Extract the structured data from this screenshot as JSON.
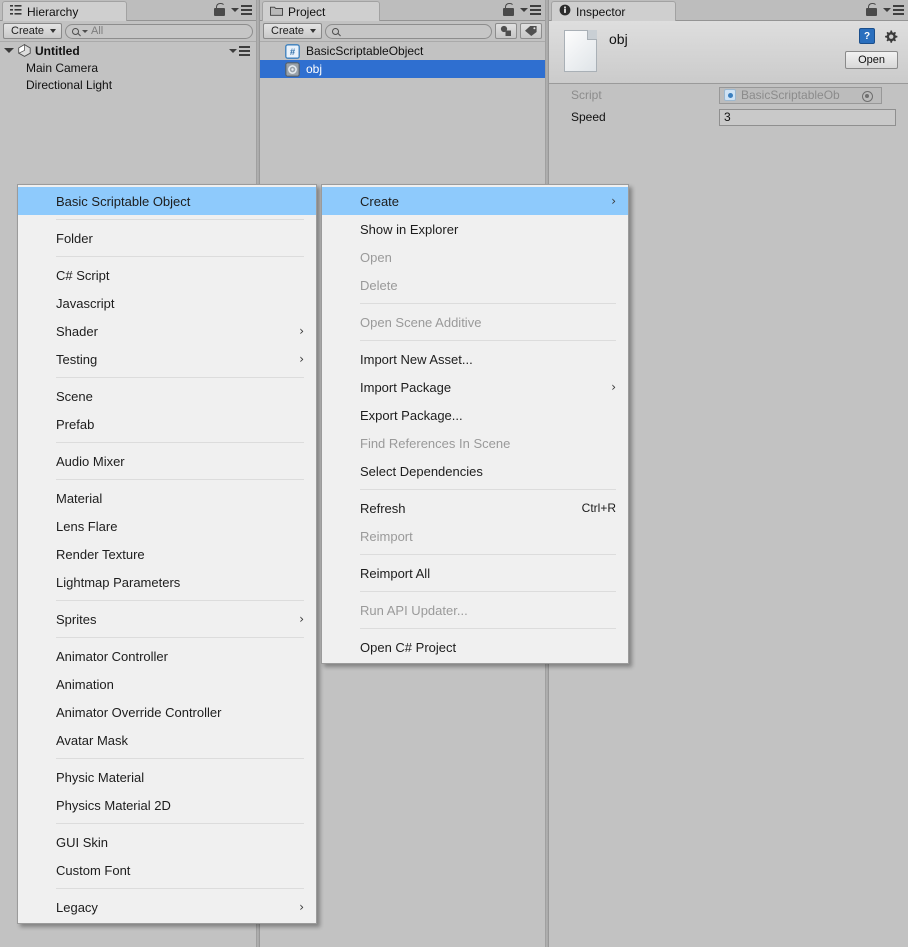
{
  "app": "Unity Editor",
  "panels": {
    "hierarchy": {
      "tab_label": "Hierarchy",
      "tab_icon": "hierarchy-icon",
      "create_label": "Create",
      "search_placeholder": "All",
      "root": {
        "label": "Untitled",
        "icon": "unity-scene-icon"
      },
      "items": [
        {
          "label": "Main Camera"
        },
        {
          "label": "Directional Light"
        }
      ]
    },
    "project": {
      "tab_label": "Project",
      "tab_icon": "folder-icon",
      "create_label": "Create",
      "search_placeholder": "",
      "filter_buttons": [
        "type-filter-icon",
        "label-filter-icon"
      ],
      "assets": [
        {
          "label": "BasicScriptableObject",
          "icon": "csharp-script-icon",
          "selected": false
        },
        {
          "label": "obj",
          "icon": "scriptable-object-asset-icon",
          "selected": true
        }
      ]
    },
    "inspector": {
      "tab_label": "Inspector",
      "tab_icon": "info-icon",
      "object_name": "obj",
      "help_icon": "?",
      "open_label": "Open",
      "properties": [
        {
          "label": "Script",
          "value": "BasicScriptableOb",
          "type": "object",
          "disabled": true
        },
        {
          "label": "Speed",
          "value": "3",
          "type": "number",
          "disabled": false
        }
      ]
    }
  },
  "context_menus": {
    "create_submenu": {
      "name": "Create",
      "items": [
        {
          "label": "Basic Scriptable Object",
          "highlighted": true
        },
        {
          "separator": true
        },
        {
          "label": "Folder"
        },
        {
          "separator": true
        },
        {
          "label": "C# Script"
        },
        {
          "label": "Javascript"
        },
        {
          "label": "Shader",
          "submenu": true
        },
        {
          "label": "Testing",
          "submenu": true
        },
        {
          "separator": true
        },
        {
          "label": "Scene"
        },
        {
          "label": "Prefab"
        },
        {
          "separator": true
        },
        {
          "label": "Audio Mixer"
        },
        {
          "separator": true
        },
        {
          "label": "Material"
        },
        {
          "label": "Lens Flare"
        },
        {
          "label": "Render Texture"
        },
        {
          "label": "Lightmap Parameters"
        },
        {
          "separator": true
        },
        {
          "label": "Sprites",
          "submenu": true
        },
        {
          "separator": true
        },
        {
          "label": "Animator Controller"
        },
        {
          "label": "Animation"
        },
        {
          "label": "Animator Override Controller"
        },
        {
          "label": "Avatar Mask"
        },
        {
          "separator": true
        },
        {
          "label": "Physic Material"
        },
        {
          "label": "Physics Material 2D"
        },
        {
          "separator": true
        },
        {
          "label": "GUI Skin"
        },
        {
          "label": "Custom Font"
        },
        {
          "separator": true
        },
        {
          "label": "Legacy",
          "submenu": true
        }
      ]
    },
    "project_context": {
      "name": "Project Context Menu",
      "items": [
        {
          "label": "Create",
          "highlighted": true,
          "submenu": true
        },
        {
          "label": "Show in Explorer"
        },
        {
          "label": "Open",
          "disabled": true
        },
        {
          "label": "Delete",
          "disabled": true
        },
        {
          "separator": true
        },
        {
          "label": "Open Scene Additive",
          "disabled": true
        },
        {
          "separator": true
        },
        {
          "label": "Import New Asset..."
        },
        {
          "label": "Import Package",
          "submenu": true
        },
        {
          "label": "Export Package..."
        },
        {
          "label": "Find References In Scene",
          "disabled": true
        },
        {
          "label": "Select Dependencies"
        },
        {
          "separator": true
        },
        {
          "label": "Refresh",
          "shortcut": "Ctrl+R"
        },
        {
          "label": "Reimport",
          "disabled": true
        },
        {
          "separator": true
        },
        {
          "label": "Reimport All"
        },
        {
          "separator": true
        },
        {
          "label": "Run API Updater...",
          "disabled": true
        },
        {
          "separator": true
        },
        {
          "label": "Open C# Project"
        }
      ]
    }
  },
  "colors": {
    "highlight": "#8ecafc",
    "selection": "#2f6fd0",
    "menu_bg": "#f0f0f0",
    "panel_bg": "#c2c2c2",
    "disabled_text": "#9a9a9a"
  }
}
